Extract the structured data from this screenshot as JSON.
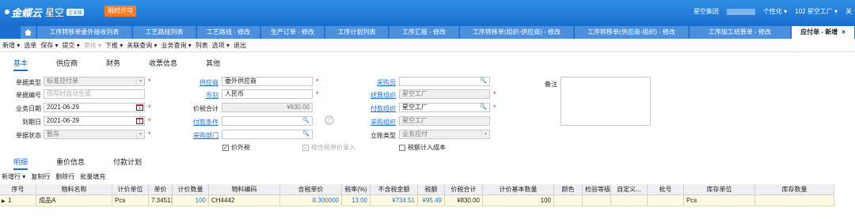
{
  "topbar": {
    "brand": "金蝶云",
    "product": "星空",
    "version": "企业版",
    "trial": "限时许可",
    "company": "星空集团",
    "personalize": "个性化 ▾",
    "org": "102 星空工厂 ▾",
    "more": "关"
  },
  "tabs": [
    {
      "label": "工序转移单委外接收列表"
    },
    {
      "label": "工艺路线列表"
    },
    {
      "label": "工艺路线 - 修改"
    },
    {
      "label": "生产订单 - 修改"
    },
    {
      "label": "工序计划列表"
    },
    {
      "label": "工序汇报 - 修改"
    },
    {
      "label": "工序转移单(组织-供应商) - 修改"
    },
    {
      "label": "工序转移单(供应商-组织) - 修改"
    },
    {
      "label": "工序加工结算单 - 修改"
    },
    {
      "label": "应付单 - 新增"
    }
  ],
  "toolbar": [
    {
      "label": "新增 ▾",
      "disabled": false
    },
    {
      "label": "选单",
      "disabled": false
    },
    {
      "label": "保存 ▾",
      "disabled": false
    },
    {
      "label": "提交 ▾",
      "disabled": false
    },
    {
      "label": "审核 ▾",
      "disabled": true
    },
    {
      "label": "下推 ▾",
      "disabled": false
    },
    {
      "label": "关联查询 ▾",
      "disabled": false
    },
    {
      "label": "业务查询 ▾",
      "disabled": false
    },
    {
      "label": "列表",
      "disabled": false
    },
    {
      "label": "选项 ▾",
      "disabled": false
    },
    {
      "label": "退出",
      "disabled": false
    }
  ],
  "header_tabs": [
    "基本",
    "供应商",
    "财务",
    "收票信息",
    "其他"
  ],
  "form": {
    "bill_type_label": "单据类型",
    "bill_type": "标准应付单",
    "bill_no_label": "单据编号",
    "bill_no_placeholder": "保存时自动生成",
    "biz_date_label": "业务日期",
    "biz_date": "2021-06-29",
    "due_date_label": "到期日",
    "due_date": "2021-06-29",
    "status_label": "单据状态",
    "status": "暂存",
    "supplier_label": "供应商",
    "supplier": "委外供应商",
    "currency_label": "币别",
    "currency": "人民币",
    "total_label": "价税合计",
    "total": "¥830.00",
    "pay_terms_label": "付款条件",
    "purchase_dept_label": "采购部门",
    "buyer_label": "采购员",
    "settle_org_label": "结算组织",
    "settle_org": "星空工厂",
    "pay_org_label": "付款组织",
    "pay_org": "星空工厂",
    "purchase_org_label": "采购组织",
    "purchase_org": "星空工厂",
    "account_type_label": "立账类型",
    "account_type": "业务应付",
    "remark_label": "备注",
    "price_incl_tax": "价外税",
    "entry_by_tax_price": "按含税单价录入",
    "tax_in_cost": "税额计入成本"
  },
  "detail_tabs": [
    "明细",
    "重价信息",
    "付款计划"
  ],
  "grid_toolbar": [
    "新增行 ▾",
    "复制行",
    "删除行",
    "批量填充"
  ],
  "grid": {
    "columns": [
      "序号",
      "物料名称",
      "计价单位",
      "单价",
      "计价数量",
      "物料编码",
      "含税单价",
      "税率(%)",
      "不含税金额",
      "税额",
      "价税合计",
      "计价基本数量",
      "颜色",
      "检验等级",
      "自定义...",
      "批号",
      "库存单位",
      "库存数量"
    ],
    "rows": [
      [
        "1",
        "成品A",
        "Pcs",
        "7.34513",
        "100",
        "CH4442",
        "8.300000",
        "13.00",
        "¥734.51",
        "¥95.49",
        "¥830.00",
        "100",
        "",
        "",
        "",
        "",
        "Pcs",
        ""
      ]
    ]
  }
}
